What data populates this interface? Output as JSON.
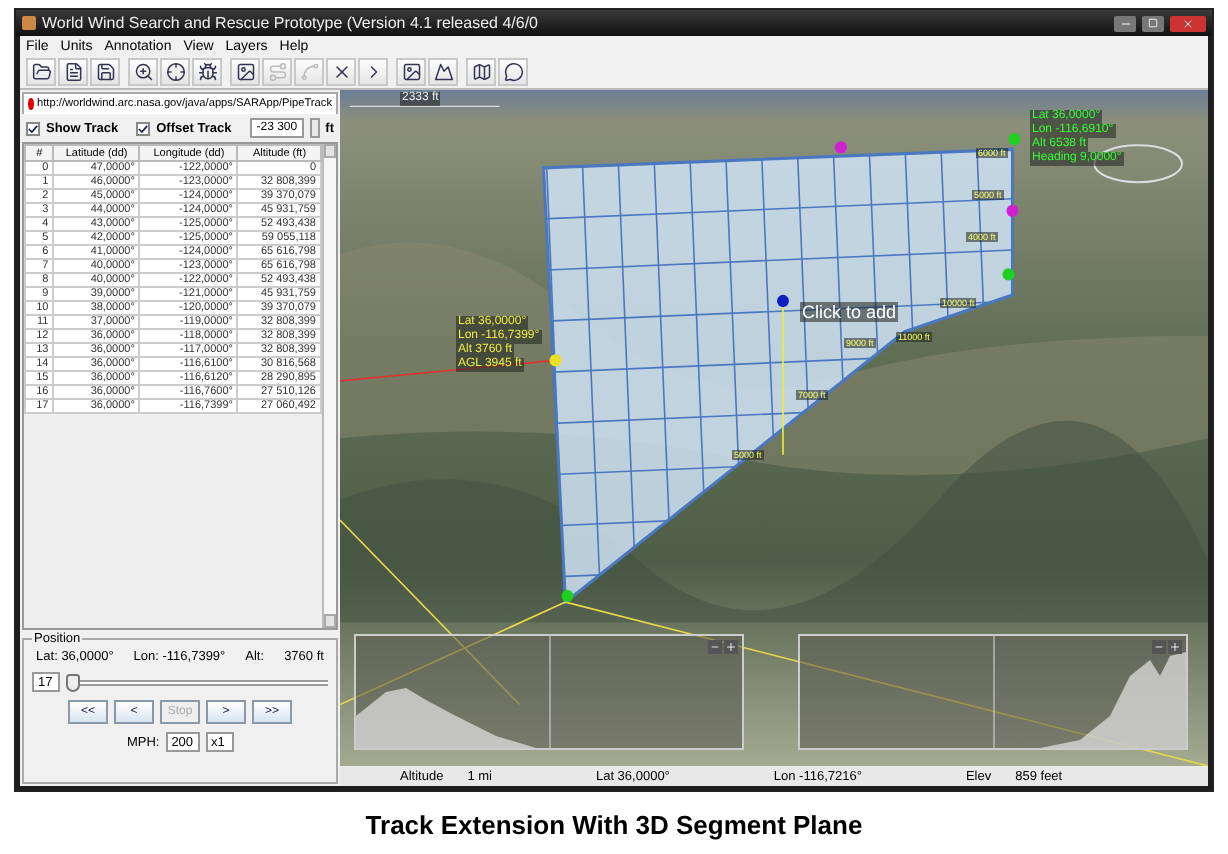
{
  "window": {
    "title": "World Wind Search and Rescue Prototype (Version 4.1 released 4/6/0"
  },
  "menu": [
    "File",
    "Units",
    "Annotation",
    "View",
    "Layers",
    "Help"
  ],
  "toolbar": [
    [
      {
        "disabled": false
      },
      {
        "disabled": false
      },
      {
        "disabled": false
      }
    ],
    [
      {
        "disabled": false
      },
      {
        "disabled": false
      },
      {
        "disabled": false
      }
    ],
    [
      {
        "disabled": false
      },
      {
        "disabled": true
      },
      {
        "disabled": true
      },
      {
        "disabled": false
      },
      {
        "disabled": false
      }
    ],
    [
      {
        "disabled": false
      },
      {
        "disabled": false
      }
    ],
    [
      {
        "disabled": false
      },
      {
        "disabled": false
      }
    ]
  ],
  "track_tab": {
    "label": "http://worldwind.arc.nasa.gov/java/apps/SARApp/PipeTrack",
    "color": "#e00000"
  },
  "options": {
    "show_track": {
      "label": "Show Track",
      "checked": true
    },
    "offset_track": {
      "label": "Offset Track",
      "checked": true
    },
    "offset_value": "-23 300",
    "unit": "ft"
  },
  "table": {
    "columns": [
      "#",
      "Latitude (dd)",
      "Longitude (dd)",
      "Altitude (ft)"
    ],
    "rows": [
      [
        "0",
        "47,0000°",
        "-122,0000°",
        "0"
      ],
      [
        "1",
        "46,0000°",
        "-123,0000°",
        "32 808,399"
      ],
      [
        "2",
        "45,0000°",
        "-124,0000°",
        "39 370,079"
      ],
      [
        "3",
        "44,0000°",
        "-124,0000°",
        "45 931,759"
      ],
      [
        "4",
        "43,0000°",
        "-125,0000°",
        "52 493,438"
      ],
      [
        "5",
        "42,0000°",
        "-125,0000°",
        "59 055,118"
      ],
      [
        "6",
        "41,0000°",
        "-124,0000°",
        "65 616,798"
      ],
      [
        "7",
        "40,0000°",
        "-123,0000°",
        "65 616,798"
      ],
      [
        "8",
        "40,0000°",
        "-122,0000°",
        "52 493,438"
      ],
      [
        "9",
        "39,0000°",
        "-121,0000°",
        "45 931,759"
      ],
      [
        "10",
        "38,0000°",
        "-120,0000°",
        "39 370,079"
      ],
      [
        "11",
        "37,0000°",
        "-119,0000°",
        "32 808,399"
      ],
      [
        "12",
        "36,0000°",
        "-118,0000°",
        "32 808,399"
      ],
      [
        "13",
        "36,0000°",
        "-117,0000°",
        "32 808,399"
      ],
      [
        "14",
        "36,0000°",
        "-116,6100°",
        "30 816,568"
      ],
      [
        "15",
        "36,0000°",
        "-116,6120°",
        "28 290,895"
      ],
      [
        "16",
        "36,0000°",
        "-116,7600°",
        "27 510,126"
      ],
      [
        "17",
        "36,0000°",
        "-116,7399°",
        "27 060,492"
      ]
    ]
  },
  "position": {
    "title": "Position",
    "lat": "Lat: 36,0000°",
    "lon": "Lon: -116,7399°",
    "alt_label": "Alt:",
    "alt_value": "3760 ft",
    "index": "17",
    "slider": {
      "level": 0.0
    },
    "buttons": [
      {
        "label": "<<",
        "disabled": false
      },
      {
        "label": "<",
        "disabled": false
      },
      {
        "label": "Stop",
        "disabled": true
      },
      {
        "label": ">",
        "disabled": false
      },
      {
        "label": ">>",
        "disabled": false
      }
    ],
    "speed_label": "MPH:",
    "speed": "200",
    "multiplier": "x1"
  },
  "map": {
    "scale": "2333 ft",
    "hint": "Click to add",
    "aircraft_info": [
      "Lat 36,0000°",
      "Lon -116,6910°",
      "Alt 6538 ft",
      "Heading 9,0000°"
    ],
    "point_info": [
      "Lat 36,0000°",
      "Lon -116,7399°",
      "Alt 3760 ft",
      "AGL 3945 ft"
    ],
    "plane_labels": [
      "6000 ft",
      "5000 ft",
      "4000 ft",
      "10000 ft",
      "11000 ft",
      "9000 ft",
      "7000 ft",
      "5000 ft"
    ],
    "status": {
      "altitude_label": "Altitude",
      "altitude": "1 mi",
      "lat": "Lat 36,0000°",
      "lon": "Lon -116,7216°",
      "elev_label": "Elev",
      "elev": "859 feet"
    }
  },
  "caption": "Track Extension With 3D Segment Plane"
}
